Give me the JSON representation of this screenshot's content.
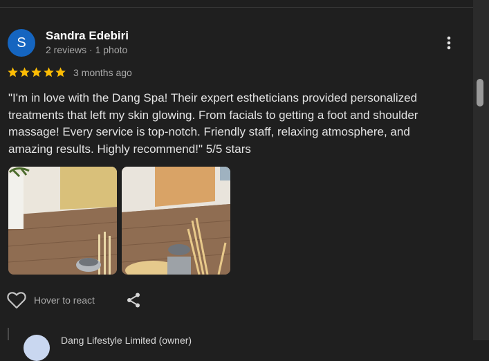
{
  "review": {
    "avatar_letter": "S",
    "name": "Sandra Edebiri",
    "meta": "2 reviews · 1 photo",
    "rating": 5,
    "time": "3 months ago",
    "text": "\"I'm in love with the Dang Spa! Their expert estheticians provided personalized treatments that left my skin glowing. From facials to getting a foot and shoulder massage! Every service is top-notch. Friendly staff, relaxing atmosphere, and amazing results. Highly recommend!\" 5/5 stars"
  },
  "actions": {
    "react_label": "Hover to react"
  },
  "owner_reply": {
    "name": "Dang Lifestyle Limited (owner)"
  },
  "colors": {
    "background": "#1f1f1f",
    "avatar": "#1565c0",
    "star": "#fbbc04"
  },
  "icons": [
    "more-vert-icon",
    "star-icon",
    "heart-outline-icon",
    "share-icon"
  ]
}
